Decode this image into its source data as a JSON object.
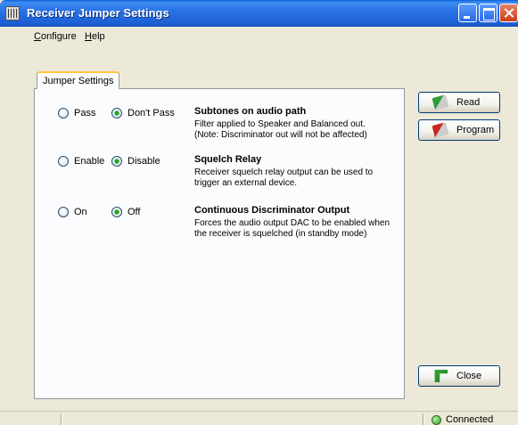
{
  "window": {
    "title": "Receiver Jumper Settings"
  },
  "menu": {
    "configure": {
      "underline": "C",
      "rest": "onfigure"
    },
    "help": {
      "underline": "H",
      "rest": "elp"
    }
  },
  "tab": {
    "label": "Jumper Settings"
  },
  "options": [
    {
      "choice_a": "Pass",
      "choice_b": "Don't Pass",
      "selected": "choice_b",
      "title": "Subtones on audio path",
      "desc": "Filter applied to Speaker and Balanced out.\n(Note:  Discriminator out will not be affected)"
    },
    {
      "choice_a": "Enable",
      "choice_b": "Disable",
      "selected": "choice_b",
      "title": "Squelch Relay",
      "desc": "Receiver squelch relay output can be used to\ntrigger an external device."
    },
    {
      "choice_a": "On",
      "choice_b": "Off",
      "selected": "choice_b",
      "title": "Continuous Discriminator Output",
      "desc": "Forces the audio output DAC to be enabled when\nthe receiver is squelched (in standby mode)"
    }
  ],
  "buttons": {
    "read": "Read",
    "program": "Program",
    "close": "Close"
  },
  "status": {
    "connection": "Connected"
  }
}
